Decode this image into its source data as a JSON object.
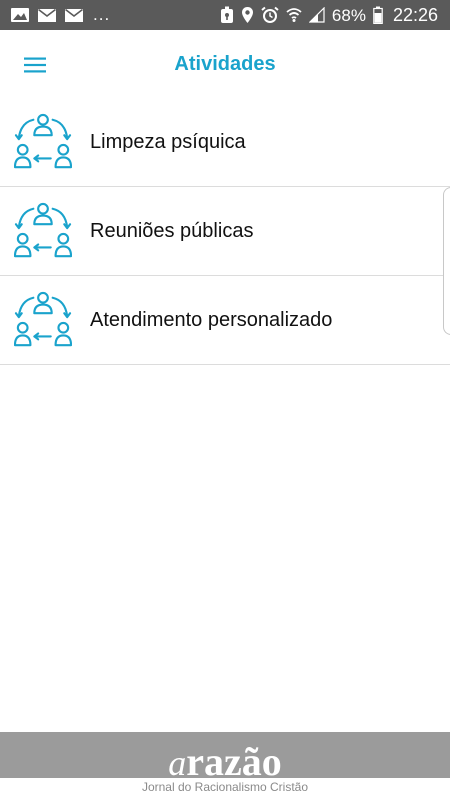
{
  "status_bar": {
    "more": "...",
    "battery": "68%",
    "time": "22:26",
    "icons": [
      "gallery-icon",
      "mail-icon",
      "mail-icon",
      "vpn-key-icon",
      "location-icon",
      "alarm-icon",
      "wifi-icon",
      "signal-icon",
      "battery-icon"
    ]
  },
  "header": {
    "title": "Atividades",
    "menu_icon": "hamburger-menu-icon",
    "accent_color": "#1aa3cc"
  },
  "activities": [
    {
      "label": "Limpeza psíquica",
      "icon": "people-cycle-icon"
    },
    {
      "label": "Reuniões públicas",
      "icon": "people-cycle-icon"
    },
    {
      "label": "Atendimento personalizado",
      "icon": "people-cycle-icon"
    }
  ],
  "footer": {
    "logo_prefix": "a",
    "logo_word": "razão",
    "tagline": "Jornal do Racionalismo Cristão",
    "band_color": "#9b9b9b"
  }
}
